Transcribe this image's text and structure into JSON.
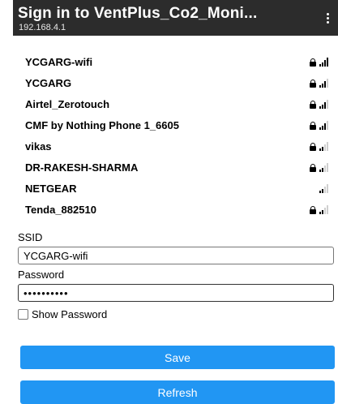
{
  "header": {
    "title": "Sign in to VentPlus_Co2_Moni...",
    "subtitle": "192.168.4.1",
    "menu_icon": "more-vert-icon"
  },
  "networks": [
    {
      "ssid": "YCGARG-wifi",
      "secured": true,
      "signal": 4
    },
    {
      "ssid": "YCGARG",
      "secured": true,
      "signal": 3
    },
    {
      "ssid": "Airtel_Zerotouch",
      "secured": true,
      "signal": 3
    },
    {
      "ssid": "CMF by Nothing Phone 1_6605",
      "secured": true,
      "signal": 3
    },
    {
      "ssid": "vikas",
      "secured": true,
      "signal": 2
    },
    {
      "ssid": "DR-RAKESH-SHARMA",
      "secured": true,
      "signal": 2
    },
    {
      "ssid": "NETGEAR",
      "secured": false,
      "signal": 2
    },
    {
      "ssid": "Tenda_882510",
      "secured": true,
      "signal": 2
    }
  ],
  "form": {
    "ssid_label": "SSID",
    "ssid_value": "YCGARG-wifi",
    "password_label": "Password",
    "password_value": "••••••••••",
    "show_password_label": "Show Password"
  },
  "buttons": {
    "save": "Save",
    "refresh": "Refresh"
  },
  "colors": {
    "header_bg": "#2c2c2c",
    "button_bg": "#2196f3"
  }
}
